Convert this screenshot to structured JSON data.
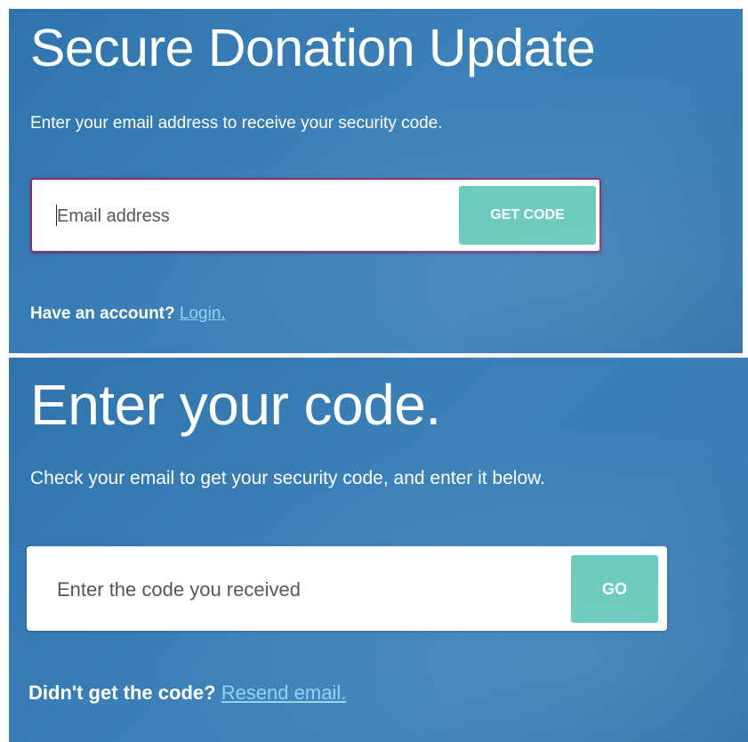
{
  "request_code": {
    "title": "Secure Donation Update",
    "subtitle": "Enter your email address to receive your security code.",
    "email_placeholder": "Email address",
    "email_value": "",
    "button_label": "GET CODE",
    "footer_prefix": "Have an account?",
    "footer_link": "Login."
  },
  "enter_code": {
    "title": "Enter your code.",
    "subtitle": "Check your email to get your security code, and enter it below.",
    "code_placeholder": "Enter the code you received",
    "code_value": "",
    "button_label": "GO",
    "footer_prefix": "Didn't get the code?",
    "footer_link": "Resend email."
  },
  "colors": {
    "background_blue": "#3a7fb8",
    "button_teal": "#63c8b8",
    "link_blue": "#8fd3f2",
    "focus_border": "#8a2c6a"
  }
}
